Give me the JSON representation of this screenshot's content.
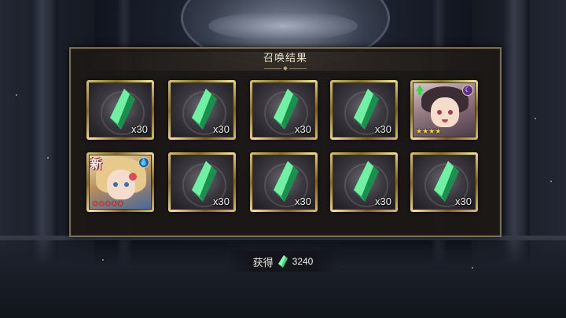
{
  "dialog": {
    "title": "召唤结果"
  },
  "results": [
    {
      "type": "crystal",
      "icon": "green-crystal-icon",
      "quantity": "x30"
    },
    {
      "type": "crystal",
      "icon": "green-crystal-icon",
      "quantity": "x30"
    },
    {
      "type": "crystal",
      "icon": "green-crystal-icon",
      "quantity": "x30"
    },
    {
      "type": "crystal",
      "icon": "green-crystal-icon",
      "quantity": "x30"
    },
    {
      "type": "character",
      "icon": "character-portrait-icon",
      "rarity_stars": "★★★★",
      "element": "moon",
      "badge": "upgrade"
    },
    {
      "type": "character",
      "icon": "character-portrait-icon",
      "rarity_stars": "★★★★★",
      "element": "water",
      "new_label": "新"
    },
    {
      "type": "crystal",
      "icon": "green-crystal-icon",
      "quantity": "x30"
    },
    {
      "type": "crystal",
      "icon": "green-crystal-icon",
      "quantity": "x30"
    },
    {
      "type": "crystal",
      "icon": "green-crystal-icon",
      "quantity": "x30"
    },
    {
      "type": "crystal",
      "icon": "green-crystal-icon",
      "quantity": "x30"
    }
  ],
  "footer": {
    "label": "获得",
    "icon": "green-crystal-icon",
    "amount": "3240"
  },
  "colors": {
    "crystal": "#3fd67a",
    "frame_gold": "#d9c27a",
    "panel_border": "#7b6c59",
    "star_gold": "#ffd84a",
    "star_red": "#ff4a4a"
  }
}
